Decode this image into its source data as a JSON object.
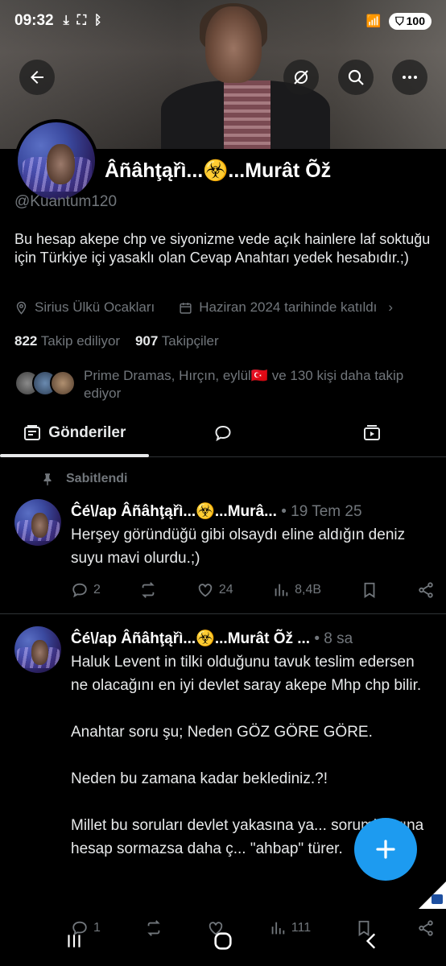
{
  "status_bar": {
    "time": "09:32",
    "battery": "100"
  },
  "profile": {
    "display_name": "Ĉé\\/ap Âñâhţąřì...☣️...Murât Õž",
    "display_name_visible": "Âñâhţąřì...☣️...Murât Õž",
    "handle": "@Kuantum120",
    "bio": "Bu hesap akepe chp ve siyonizme vede açık hainlere laf soktuğu için Türkiye içi yasaklı olan Cevap Anahtarı yedek hesabıdır.;)",
    "location": "Sirius Ülkü Ocakları",
    "joined": "Haziran 2024 tarihinde katıldı",
    "following_count": "822",
    "following_label": "Takip ediliyor",
    "followers_count": "907",
    "followers_label": "Takipçiler",
    "followed_by": "Prime Dramas, Hırçın, eylül🇹🇷 ve 130 kişi daha takip ediyor"
  },
  "tabs": [
    {
      "label": "Gönderiler",
      "icon": "posts-icon",
      "active": true
    },
    {
      "label": "",
      "icon": "replies-icon",
      "active": false
    },
    {
      "label": "",
      "icon": "media-icon",
      "active": false
    }
  ],
  "pinned_label": "Sabitlendi",
  "posts": [
    {
      "name": "Ĉé\\/ap Âñâhţąřì...☣️...Murâ...",
      "meta": "• 19 Tem 25",
      "text": "Herşey göründüğü gibi olsaydı eline aldığın deniz suyu mavi olurdu.;)",
      "replies": "2",
      "reposts": "",
      "likes": "24",
      "views": "8,4B"
    },
    {
      "name": "Ĉé\\/ap Âñâhţąřì...☣️...Murât Õž ...",
      "meta": "• 8 sa",
      "text": "Haluk Levent in tilki olduğunu tavuk teslim edersen ne olacağını en iyi devlet saray akepe Mhp chp bilir.\n\nAnahtar soru şu; Neden GÖZ GÖRE GÖRE.\n\nNeden bu zamana kadar beklediniz.?!\n\nMillet bu soruları devlet yakasına ya... sorumlularına hesap sormazsa daha ç... \"ahbap\" türer.",
      "replies": "1",
      "reposts": "",
      "likes": "",
      "views": "111"
    }
  ],
  "colors": {
    "accent": "#1d9bf0",
    "background": "#000000",
    "muted": "#71767b",
    "text": "#e7e9ea"
  }
}
